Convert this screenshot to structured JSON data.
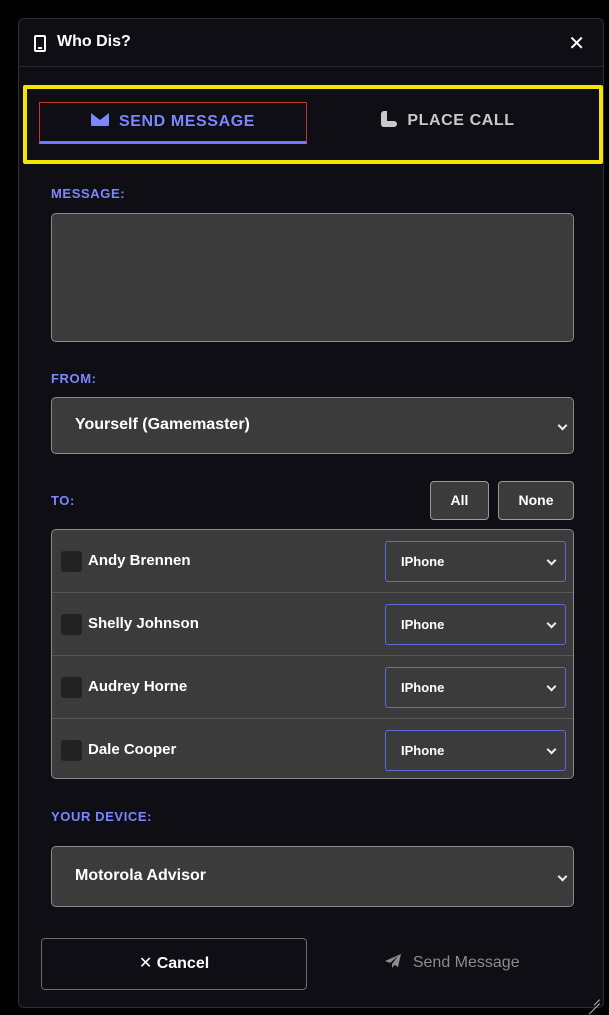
{
  "window": {
    "title": "Who Dis?",
    "close_label": "✕"
  },
  "tabs": [
    {
      "label": "SEND MESSAGE",
      "active": true
    },
    {
      "label": "PLACE CALL",
      "active": false
    }
  ],
  "message": {
    "label": "MESSAGE:",
    "value": ""
  },
  "from": {
    "label": "FROM:",
    "selected": "Yourself (Gamemaster)"
  },
  "to": {
    "label": "TO:",
    "all_label": "All",
    "none_label": "None",
    "recipients": [
      {
        "name": "Andy Brennen",
        "device": "IPhone",
        "checked": false
      },
      {
        "name": "Shelly Johnson",
        "device": "IPhone",
        "checked": false
      },
      {
        "name": "Audrey Horne",
        "device": "IPhone",
        "checked": false
      },
      {
        "name": "Dale Cooper",
        "device": "IPhone",
        "checked": false
      }
    ]
  },
  "your_device": {
    "label": "YOUR DEVICE:",
    "selected": "Motorola Advisor"
  },
  "footer": {
    "cancel_label": "Cancel",
    "cancel_icon": "✕",
    "send_label": "Send Message",
    "send_icon": "paper-plane-icon"
  },
  "colors": {
    "accent": "#7b87ff",
    "highlight_frame": "#f5e400",
    "field_bg": "#3b3b3b",
    "window_bg": "#0e0e14"
  }
}
